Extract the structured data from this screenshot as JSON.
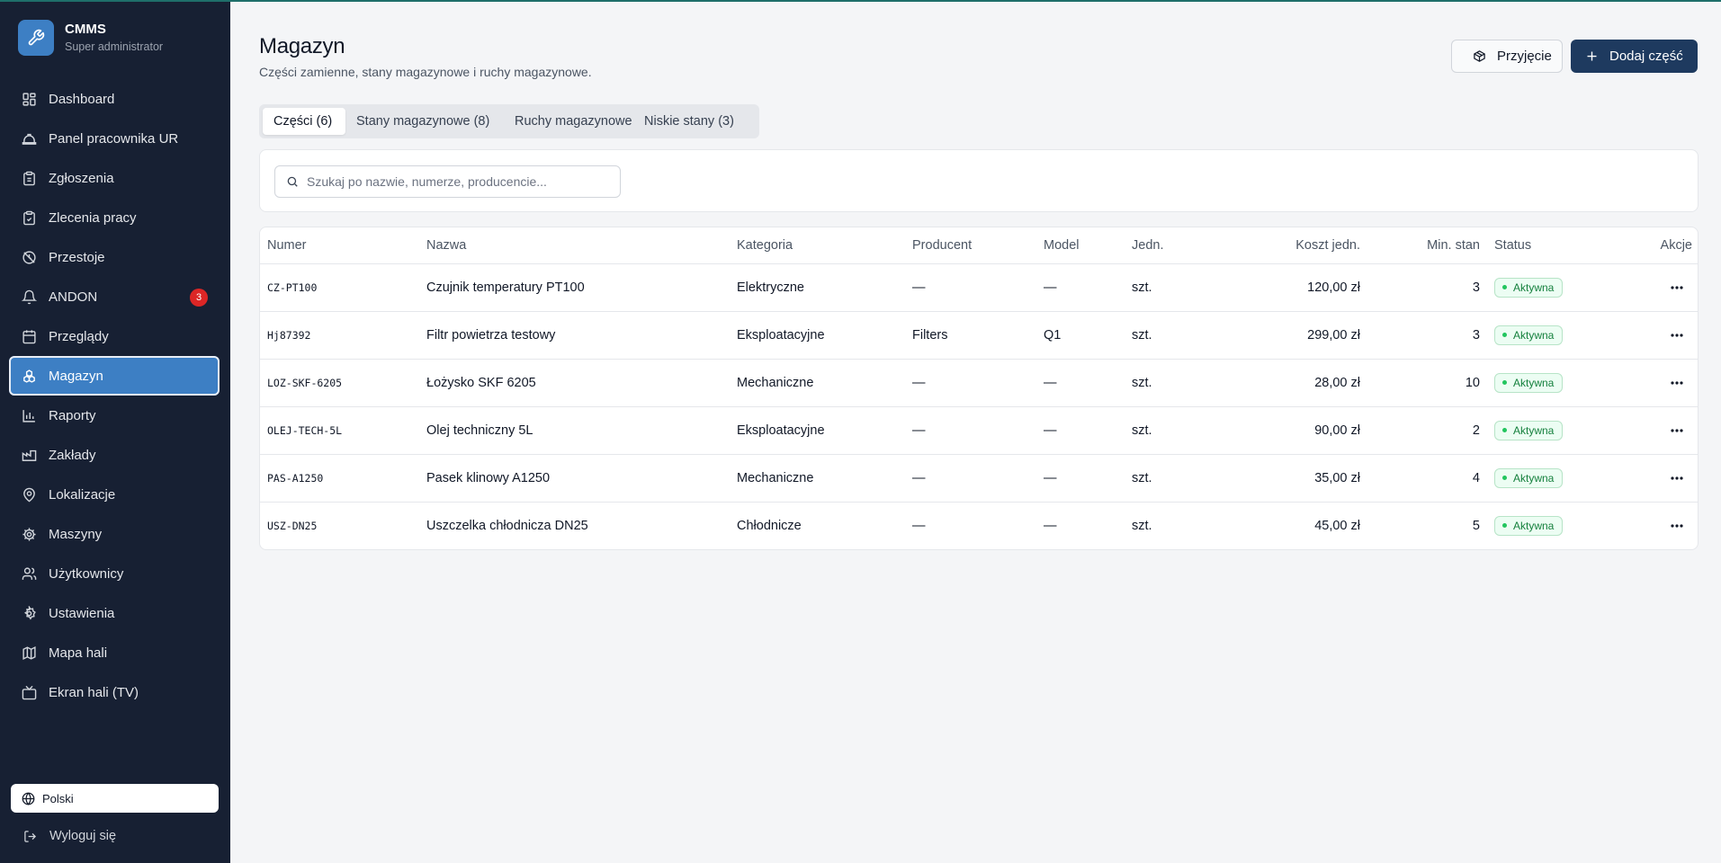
{
  "app": {
    "title": "CMMS",
    "role": "Super administrator"
  },
  "sidebar": {
    "items": [
      {
        "label": "Dashboard",
        "icon": "dashboard-icon"
      },
      {
        "label": "Panel pracownika UR",
        "icon": "hard-hat-icon"
      },
      {
        "label": "Zgłoszenia",
        "icon": "clipboard-icon"
      },
      {
        "label": "Zlecenia pracy",
        "icon": "clipboard-check-icon"
      },
      {
        "label": "Przestoje",
        "icon": "clock-off-icon"
      },
      {
        "label": "ANDON",
        "icon": "bell-icon",
        "badge": "3"
      },
      {
        "label": "Przeglądy",
        "icon": "calendar-icon"
      },
      {
        "label": "Magazyn",
        "icon": "boxes-icon",
        "active": true
      },
      {
        "label": "Raporty",
        "icon": "bar-chart-icon"
      },
      {
        "label": "Zakłady",
        "icon": "factory-icon"
      },
      {
        "label": "Lokalizacje",
        "icon": "map-pin-icon"
      },
      {
        "label": "Maszyny",
        "icon": "cog-icon"
      },
      {
        "label": "Użytkownicy",
        "icon": "users-icon"
      },
      {
        "label": "Ustawienia",
        "icon": "settings-icon"
      },
      {
        "label": "Mapa hali",
        "icon": "map-icon"
      },
      {
        "label": "Ekran hali (TV)",
        "icon": "tv-icon"
      }
    ],
    "language": "Polski",
    "logout": "Wyloguj się"
  },
  "header": {
    "title": "Magazyn",
    "subtitle": "Części zamienne, stany magazynowe i ruchy magazynowe.",
    "receive_button": "Przyjęcie",
    "add_button": "Dodaj część"
  },
  "tabs": [
    {
      "label": "Części (6)",
      "active": true
    },
    {
      "label": "Stany magazynowe (8)"
    },
    {
      "label": "Ruchy magazynowe"
    },
    {
      "label": "Niskie stany (3)"
    }
  ],
  "search": {
    "placeholder": "Szukaj po nazwie, numerze, producencie...",
    "value": ""
  },
  "table": {
    "columns": [
      "Numer",
      "Nazwa",
      "Kategoria",
      "Producent",
      "Model",
      "Jedn.",
      "Koszt jedn.",
      "Min. stan",
      "Status",
      "Akcje"
    ],
    "rows": [
      {
        "numer": "CZ-PT100",
        "nazwa": "Czujnik temperatury PT100",
        "kategoria": "Elektryczne",
        "producent": "—",
        "model": "—",
        "jedn": "szt.",
        "koszt": "120,00 zł",
        "min": "3",
        "status": "Aktywna"
      },
      {
        "numer": "Hj87392",
        "nazwa": "Filtr powietrza testowy",
        "kategoria": "Eksploatacyjne",
        "producent": "Filters",
        "model": "Q1",
        "jedn": "szt.",
        "koszt": "299,00 zł",
        "min": "3",
        "status": "Aktywna"
      },
      {
        "numer": "LOZ-SKF-6205",
        "nazwa": "Łożysko SKF 6205",
        "kategoria": "Mechaniczne",
        "producent": "—",
        "model": "—",
        "jedn": "szt.",
        "koszt": "28,00 zł",
        "min": "10",
        "status": "Aktywna"
      },
      {
        "numer": "OLEJ-TECH-5L",
        "nazwa": "Olej techniczny 5L",
        "kategoria": "Eksploatacyjne",
        "producent": "—",
        "model": "—",
        "jedn": "szt.",
        "koszt": "90,00 zł",
        "min": "2",
        "status": "Aktywna"
      },
      {
        "numer": "PAS-A1250",
        "nazwa": "Pasek klinowy A1250",
        "kategoria": "Mechaniczne",
        "producent": "—",
        "model": "—",
        "jedn": "szt.",
        "koszt": "35,00 zł",
        "min": "4",
        "status": "Aktywna"
      },
      {
        "numer": "USZ-DN25",
        "nazwa": "Uszczelka chłodnicza DN25",
        "kategoria": "Chłodnicze",
        "producent": "—",
        "model": "—",
        "jedn": "szt.",
        "koszt": "45,00 zł",
        "min": "5",
        "status": "Aktywna"
      }
    ]
  },
  "colors": {
    "sidebar_bg": "#172033",
    "accent": "#3d7fc4",
    "primary_button": "#1e3a5f",
    "badge": "#dc2626",
    "status_green": "#15803d"
  }
}
